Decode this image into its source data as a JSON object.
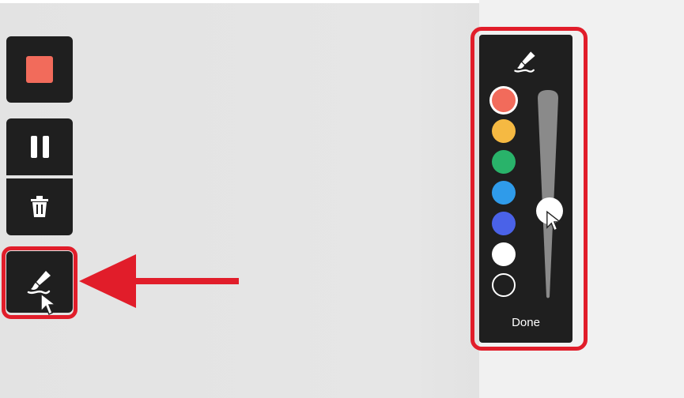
{
  "toolbar": {
    "buttons": [
      {
        "name": "stop",
        "icon": "stop-icon",
        "color": "#f26b5b"
      },
      {
        "name": "pause",
        "icon": "pause-icon"
      },
      {
        "name": "delete",
        "icon": "trash-icon"
      },
      {
        "name": "draw",
        "icon": "brush-icon"
      }
    ]
  },
  "draw_panel": {
    "icon": "brush-icon",
    "colors": [
      "#f26b5b",
      "#f5b942",
      "#29b36a",
      "#2f9bea",
      "#4a62e8",
      "#ffffff",
      "none"
    ],
    "selected_color": "#f26b5b",
    "size_level": 0.5,
    "done_label": "Done"
  },
  "annotation": {
    "highlight_color": "#e11d2a"
  }
}
